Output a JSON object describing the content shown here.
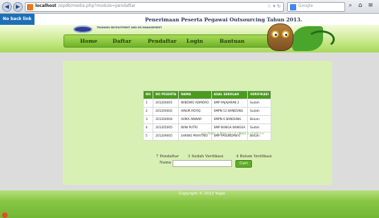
{
  "browser": {
    "url_host": "localhost",
    "url_path": "/sipdb/media.php?module=pendaftar",
    "search_placeholder": "Google",
    "nav_icons": [
      "back-icon",
      "forward-icon"
    ],
    "search_glyph": "⌕",
    "home_glyph": "⌂",
    "menu_glyph": "≡"
  },
  "site": {
    "back_link": "No back link",
    "title": "Penerimaan Peserta Pegawai Outsourcing Tahun 2013.",
    "logo_text": "TRAINING RECRUITMENT AND HR MANAGEMENT"
  },
  "menu": [
    {
      "label": "Home"
    },
    {
      "label": "Daftar"
    },
    {
      "label": "Pendaftar"
    },
    {
      "label": "Login"
    },
    {
      "label": "Bantuan"
    }
  ],
  "table": {
    "headers": [
      "NO",
      "NO PESERTA",
      "NAMA",
      "ASAL SEKOLAH",
      "VERIFIKASI"
    ],
    "rows": [
      [
        "1",
        "201204001",
        "WIBOWO ADMORO",
        "SMP PAJAJARAN 2",
        "Sudah"
      ],
      [
        "2",
        "201204002",
        "AINUR ROFIQ",
        "SMPN 12 BANDUNG",
        "Sudah"
      ],
      [
        "3",
        "201204004",
        "AVIKA ANWAR",
        "SMPN 6 BANDUNG",
        "Belum"
      ],
      [
        "4",
        "201205005",
        "WINI PUTRI",
        "SMP BUNGA BANGSA",
        "Sudah"
      ],
      [
        "5",
        "201209005",
        "SARWO PRAYITNO",
        "SMP PASUNDAN 6",
        "Belum"
      ]
    ],
    "pager": "<< First | < Prev | 1 | 2 | Next > | Last >>"
  },
  "stats": {
    "pendaftar": "7 Pendaftar",
    "sudah": "3 Sudah Verifikasi",
    "belum": "4 Belum Verifikasi"
  },
  "search": {
    "label": "Nama",
    "value": "",
    "button": "Cari"
  },
  "footer": {
    "text": "Copyright © 2013 Yogie"
  }
}
